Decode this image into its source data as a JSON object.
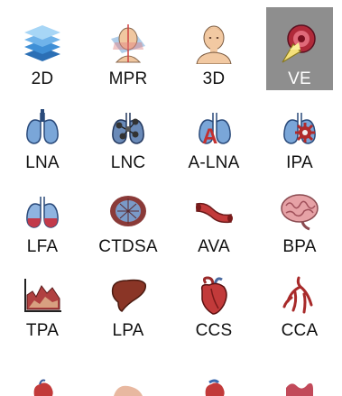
{
  "toolbar": {
    "items": [
      {
        "label": "2D",
        "icon": "layers-stack-icon",
        "selected": false
      },
      {
        "label": "MPR",
        "icon": "head-planes-icon",
        "selected": false
      },
      {
        "label": "3D",
        "icon": "head-bust-icon",
        "selected": false
      },
      {
        "label": "VE",
        "icon": "virtual-endoscopy-icon",
        "selected": true
      },
      {
        "label": "LNA",
        "icon": "lungs-icon",
        "selected": false
      },
      {
        "label": "LNC",
        "icon": "lungs-nodes-icon",
        "selected": false
      },
      {
        "label": "A-LNA",
        "icon": "lungs-letter-a-icon",
        "selected": false
      },
      {
        "label": "IPA",
        "icon": "lungs-gear-icon",
        "selected": false
      },
      {
        "label": "LFA",
        "icon": "lungs-red-icon",
        "selected": false
      },
      {
        "label": "CTDSA",
        "icon": "brain-grid-icon",
        "selected": false
      },
      {
        "label": "AVA",
        "icon": "vessel-icon",
        "selected": false
      },
      {
        "label": "BPA",
        "icon": "brain-pink-icon",
        "selected": false
      },
      {
        "label": "TPA",
        "icon": "tissue-chart-icon",
        "selected": false
      },
      {
        "label": "LPA",
        "icon": "liver-icon",
        "selected": false
      },
      {
        "label": "CCS",
        "icon": "heart-icon",
        "selected": false
      },
      {
        "label": "CCA",
        "icon": "coronary-arteries-icon",
        "selected": false
      }
    ]
  },
  "colors": {
    "selected_bg": "#8e8e8e",
    "lung_blue": "#7aa6d8",
    "organ_red": "#b23a3a",
    "liver_brown": "#8a3526"
  }
}
